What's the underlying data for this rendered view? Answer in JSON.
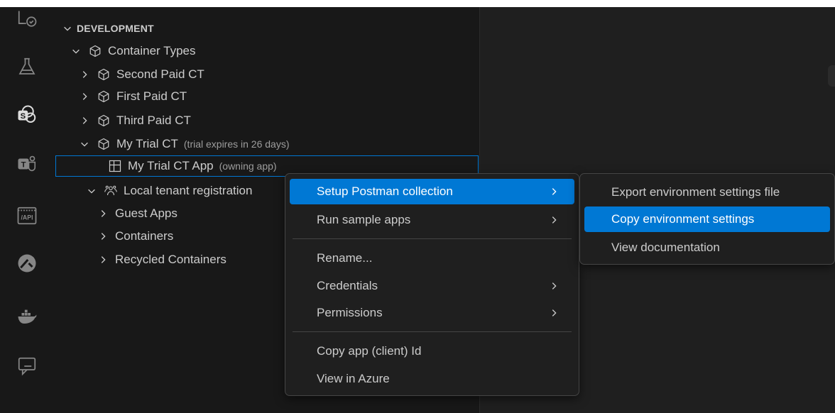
{
  "section": {
    "title": "DEVELOPMENT"
  },
  "tree": {
    "container_types": "Container Types",
    "second_paid": "Second Paid CT",
    "first_paid": "First Paid CT",
    "third_paid": "Third Paid CT",
    "my_trial": "My Trial CT",
    "my_trial_desc": "(trial expires in 26 days)",
    "app": "My Trial CT App",
    "app_desc": "(owning app)",
    "local_tenant": "Local tenant registration",
    "guest_apps": "Guest Apps",
    "containers": "Containers",
    "recycled": "Recycled Containers"
  },
  "context_menu": {
    "items": [
      {
        "label": "Setup Postman collection",
        "submenu": true,
        "active": true
      },
      {
        "label": "Run sample apps",
        "submenu": true
      },
      {
        "label": "Rename..."
      },
      {
        "label": "Credentials",
        "submenu": true
      },
      {
        "label": "Permissions",
        "submenu": true
      },
      {
        "label": "Copy app (client) Id"
      },
      {
        "label": "View in Azure"
      }
    ]
  },
  "submenu": {
    "items": [
      {
        "label": "Export environment settings file"
      },
      {
        "label": "Copy environment settings",
        "active": true
      },
      {
        "label": "View documentation"
      }
    ]
  },
  "activity_bar": {
    "icons": [
      "remote-explorer-icon",
      "testing-flask-icon",
      "sharepoint-icon",
      "teams-toolkit-icon",
      "api-icon",
      "kubernetes-icon",
      "docker-icon",
      "chat-icon"
    ]
  },
  "colors": {
    "accent": "#0078d4",
    "sidebar_bg": "#181818",
    "editor_bg": "#1f1f1f",
    "text": "#cccccc",
    "description": "#9d9d9d"
  }
}
